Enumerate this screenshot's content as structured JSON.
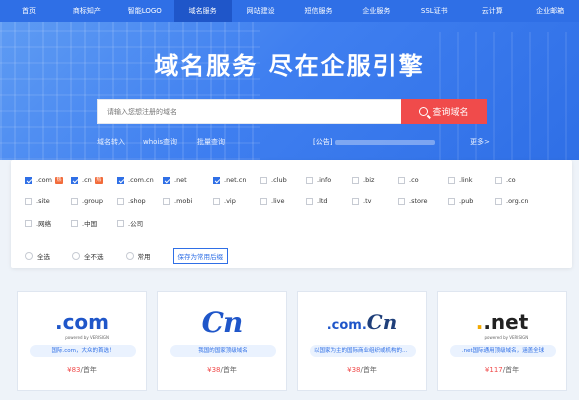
{
  "nav": {
    "items": [
      {
        "label": "首页",
        "active": false
      },
      {
        "label": "商标知产",
        "active": false
      },
      {
        "label": "智能LOGO",
        "active": false
      },
      {
        "label": "域名服务",
        "active": true
      },
      {
        "label": "网站建设",
        "active": false
      },
      {
        "label": "短信服务",
        "active": false
      },
      {
        "label": "企业服务",
        "active": false
      },
      {
        "label": "SSL证书",
        "active": false
      },
      {
        "label": "云计算",
        "active": false
      },
      {
        "label": "企业邮箱",
        "active": false
      }
    ]
  },
  "hero": {
    "title": "域名服务 尽在企服引擎",
    "search_placeholder": "请输入您想注册的域名",
    "search_button": "查询域名",
    "links": [
      "域名转入",
      "whois查询",
      "批量查询"
    ],
    "notice_label": "公告",
    "more": "更多>"
  },
  "suffixes": [
    {
      "label": ".com",
      "checked": true,
      "badge": "热"
    },
    {
      "label": ".cn",
      "checked": true,
      "badge": "热"
    },
    {
      "label": ".com.cn",
      "checked": true,
      "badge": ""
    },
    {
      "label": ".net",
      "checked": true,
      "badge": ""
    },
    {
      "label": ".net.cn",
      "checked": true,
      "badge": ""
    },
    {
      "label": ".club",
      "checked": false,
      "badge": ""
    },
    {
      "label": ".info",
      "checked": false,
      "badge": ""
    },
    {
      "label": ".biz",
      "checked": false,
      "badge": ""
    },
    {
      "label": ".co",
      "checked": false,
      "badge": ""
    },
    {
      "label": ".link",
      "checked": false,
      "badge": ""
    },
    {
      "label": ".co",
      "checked": false,
      "badge": ""
    },
    {
      "label": ".site",
      "checked": false,
      "badge": ""
    },
    {
      "label": ".group",
      "checked": false,
      "badge": ""
    },
    {
      "label": ".shop",
      "checked": false,
      "badge": ""
    },
    {
      "label": ".mobi",
      "checked": false,
      "badge": ""
    },
    {
      "label": ".vip",
      "checked": false,
      "badge": ""
    },
    {
      "label": ".live",
      "checked": false,
      "badge": ""
    },
    {
      "label": ".ltd",
      "checked": false,
      "badge": ""
    },
    {
      "label": ".tv",
      "checked": false,
      "badge": ""
    },
    {
      "label": ".store",
      "checked": false,
      "badge": ""
    },
    {
      "label": ".pub",
      "checked": false,
      "badge": ""
    },
    {
      "label": ".org.cn",
      "checked": false,
      "badge": ""
    },
    {
      "label": ".网络",
      "checked": false,
      "badge": ""
    },
    {
      "label": ".中国",
      "checked": false,
      "badge": ""
    },
    {
      "label": ".公司",
      "checked": false,
      "badge": ""
    }
  ],
  "selection": {
    "select_all": "全选",
    "select_none": "全不选",
    "common": "常用",
    "save": "保存为常用后缀"
  },
  "products": [
    {
      "logo": ".com",
      "logo_sub": "powered by VERISIGN",
      "desc": "国际.com，大众的首选！",
      "price": "¥83",
      "unit": "/首年"
    },
    {
      "logo": "Cn",
      "desc": "我国的国家顶级域名",
      "price": "¥38",
      "unit": "/首年"
    },
    {
      "logo_a": ".com.",
      "logo_b": "Cn",
      "desc": "以国家为主的国际商业组织或机构的域名",
      "price": "¥38",
      "unit": "/首年"
    },
    {
      "logo": ".net",
      "logo_sub": "powered by VERISIGN",
      "desc": ".net国际通用顶级域名，涵盖全球",
      "price": "¥117",
      "unit": "/首年"
    }
  ]
}
